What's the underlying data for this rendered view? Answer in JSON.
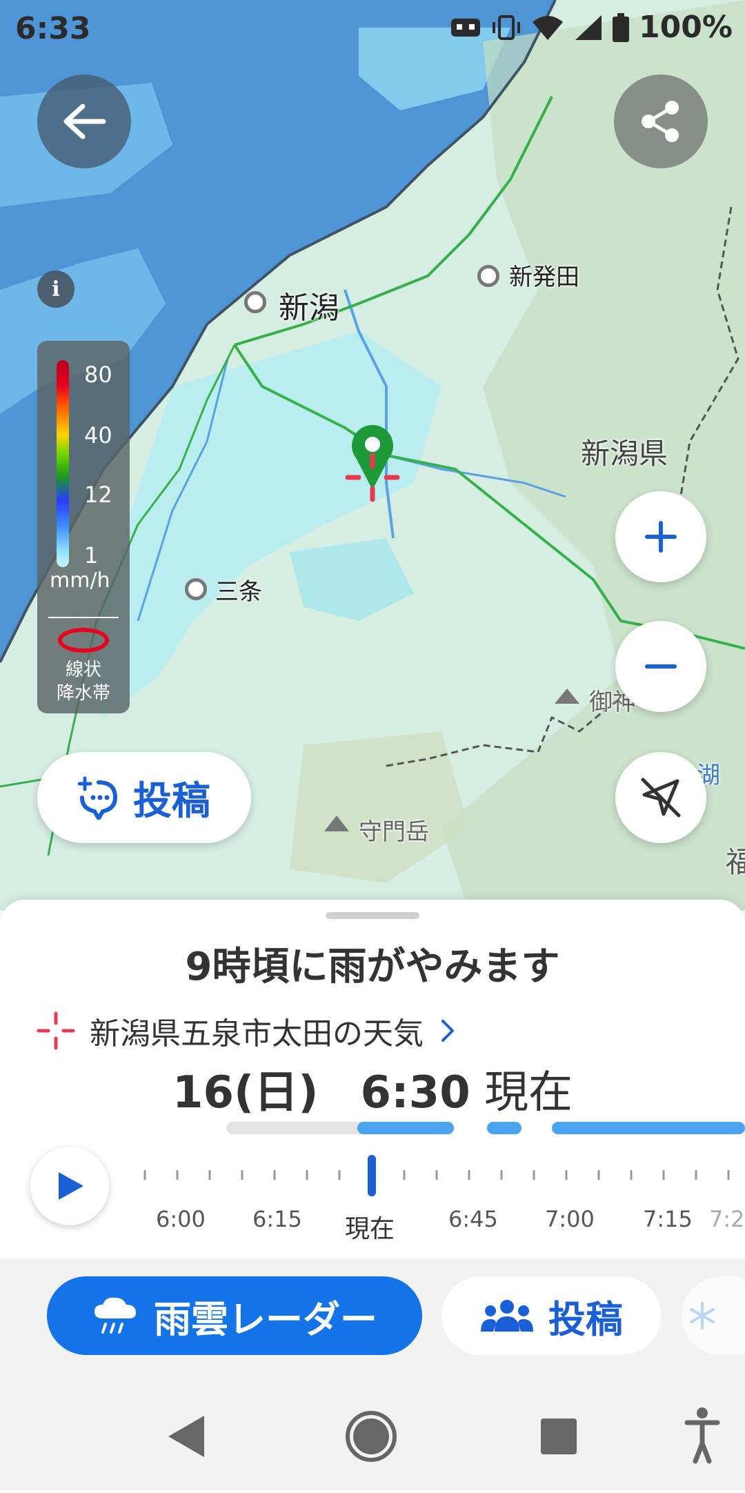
{
  "status_bar": {
    "time": "6:33",
    "battery": "100%"
  },
  "map": {
    "places": [
      {
        "name": "新潟",
        "kind": "city-large"
      },
      {
        "name": "新発田",
        "kind": "city"
      },
      {
        "name": "三条",
        "kind": "city"
      },
      {
        "name": "新潟県",
        "kind": "prefecture"
      },
      {
        "name": "守門岳",
        "kind": "mountain"
      },
      {
        "name": "御神",
        "kind": "mountain"
      },
      {
        "name": "湖",
        "kind": "lake"
      },
      {
        "name": "福",
        "kind": "prefecture"
      }
    ],
    "legend": {
      "values": [
        "80",
        "40",
        "12",
        "1"
      ],
      "unit": "mm/h",
      "linear_band_label_1": "線状",
      "linear_band_label_2": "降水帯"
    },
    "post_button_label": "投稿",
    "info_label": "i"
  },
  "sheet": {
    "headline": "9時頃に雨がやみます",
    "location": "新潟県五泉市太田の天気",
    "date": "16(日)",
    "time": "6:30",
    "current_suffix": "現在",
    "timeline_labels": [
      "6:00",
      "6:15",
      "現在",
      "6:45",
      "7:00",
      "7:15",
      "7:2"
    ]
  },
  "tabs": [
    {
      "label": "雨雲レーダー",
      "active": true
    },
    {
      "label": "投稿",
      "active": false
    }
  ],
  "colors": {
    "accent": "#1473e6",
    "marker": "#1e9a3a",
    "crosshair": "#e83b4f",
    "rain_bar": "#4aa3ef"
  }
}
